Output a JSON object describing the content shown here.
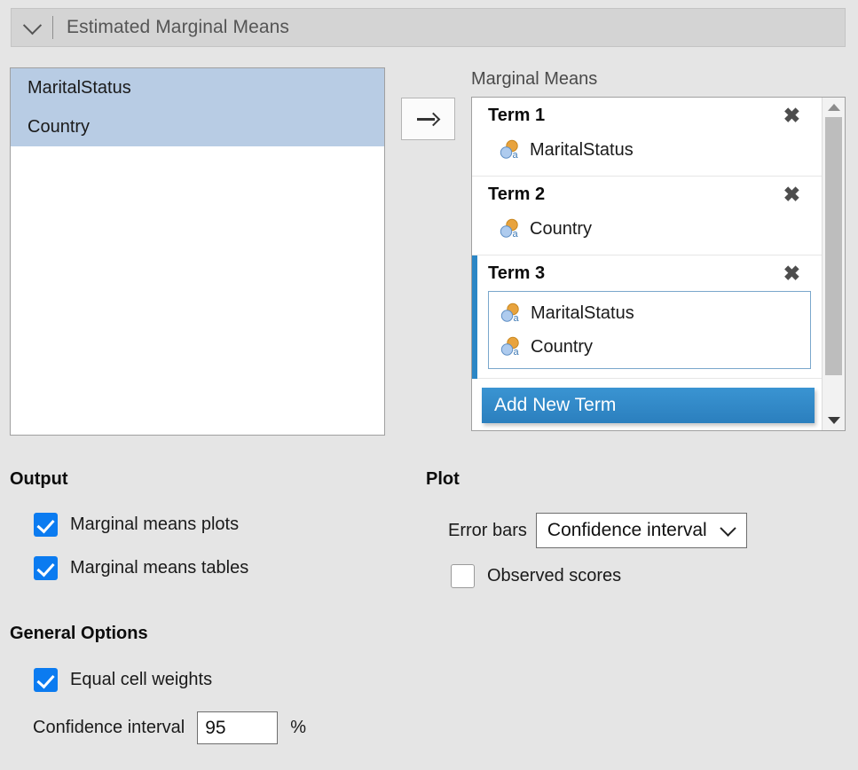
{
  "header": {
    "title": "Estimated Marginal Means",
    "collapse_icon": "chevron-down-icon"
  },
  "source_list": {
    "items": [
      {
        "label": "MaritalStatus",
        "selected": true
      },
      {
        "label": "Country",
        "selected": true
      }
    ]
  },
  "transfer": {
    "arrow_icon": "arrow-right-icon"
  },
  "marginal_means": {
    "label": "Marginal Means",
    "remove_icon": "close-icon",
    "variable_icon": "nominal-variable-icon",
    "terms": [
      {
        "title": "Term 1",
        "selected": false,
        "boxed": false,
        "variables": [
          "MaritalStatus"
        ]
      },
      {
        "title": "Term 2",
        "selected": false,
        "boxed": false,
        "variables": [
          "Country"
        ]
      },
      {
        "title": "Term 3",
        "selected": true,
        "boxed": true,
        "variables": [
          "MaritalStatus",
          "Country"
        ]
      }
    ],
    "add_new_term_label": "Add New Term",
    "scrollbar": {
      "up_icon": "triangle-up-icon",
      "down_icon": "triangle-down-icon"
    }
  },
  "output": {
    "title": "Output",
    "checkboxes": [
      {
        "label": "Marginal means plots",
        "checked": true
      },
      {
        "label": "Marginal means tables",
        "checked": true
      }
    ]
  },
  "plot": {
    "title": "Plot",
    "error_bars_label": "Error bars",
    "error_bars_value": "Confidence interval",
    "error_bars_chevron": "chevron-down-icon",
    "observed_scores": {
      "label": "Observed scores",
      "checked": false
    }
  },
  "general_options": {
    "title": "General Options",
    "equal_cell_weights": {
      "label": "Equal cell weights",
      "checked": true
    },
    "confidence_interval_label": "Confidence interval",
    "confidence_interval_value": "95",
    "percent_symbol": "%"
  },
  "colors": {
    "window_background": "#e5e5e5",
    "selection_blue": "#b8cce4",
    "accent_blue": "#2b86c5",
    "checkbox_blue": "#0b7bf0",
    "icon_orange": "#e8a33d",
    "icon_blue": "#8eb8e5"
  }
}
